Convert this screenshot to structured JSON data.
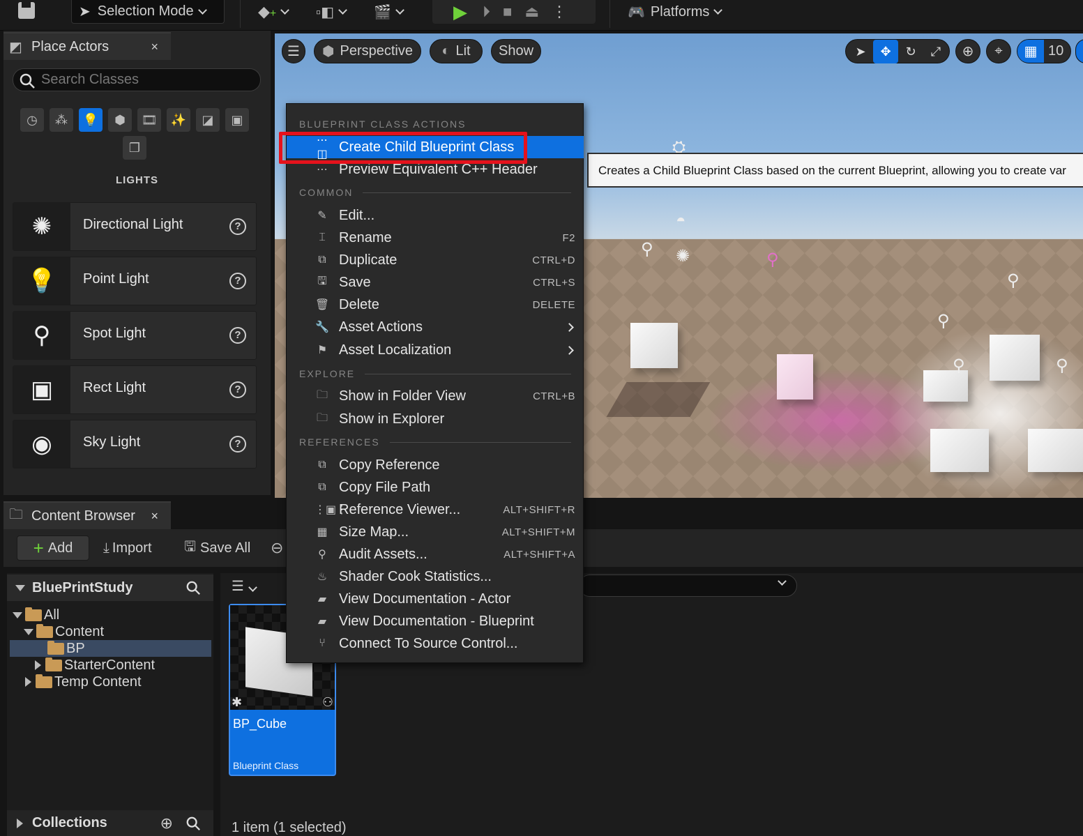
{
  "toolbar": {
    "mode_label": "Selection Mode",
    "platforms_label": "Platforms"
  },
  "place_actors": {
    "tab_title": "Place Actors",
    "close": "×",
    "search_placeholder": "Search Classes",
    "category_heading": "LIGHTS",
    "categories": [
      "recent-icon",
      "basic-icon",
      "lights-icon",
      "shapes-icon",
      "cinematic-icon",
      "visual-effects-icon",
      "geometry-icon",
      "volumes-icon",
      "all-classes-icon"
    ],
    "items": [
      {
        "label": "Directional Light",
        "icon": "directional-light-icon"
      },
      {
        "label": "Point Light",
        "icon": "point-light-icon"
      },
      {
        "label": "Spot Light",
        "icon": "spot-light-icon"
      },
      {
        "label": "Rect Light",
        "icon": "rect-light-icon"
      },
      {
        "label": "Sky Light",
        "icon": "sky-light-icon"
      }
    ]
  },
  "viewport": {
    "perspective_label": "Perspective",
    "lit_label": "Lit",
    "show_label": "Show",
    "grid_value": "10"
  },
  "tooltip": {
    "text": "Creates a Child Blueprint Class based on the current Blueprint, allowing you to create var"
  },
  "context_menu": {
    "sections": {
      "blueprint": "BLUEPRINT CLASS ACTIONS",
      "common": "COMMON",
      "explore": "EXPLORE",
      "references": "REFERENCES"
    },
    "items": {
      "create_child": {
        "label": "Create Child Blueprint Class",
        "shortcut": ""
      },
      "preview_header": {
        "label": "Preview Equivalent C++ Header",
        "shortcut": ""
      },
      "edit": {
        "label": "Edit...",
        "shortcut": ""
      },
      "rename": {
        "label": "Rename",
        "shortcut": "F2"
      },
      "duplicate": {
        "label": "Duplicate",
        "shortcut": "CTRL+D"
      },
      "save": {
        "label": "Save",
        "shortcut": "CTRL+S"
      },
      "delete": {
        "label": "Delete",
        "shortcut": "DELETE"
      },
      "asset_actions": {
        "label": "Asset Actions",
        "shortcut": ""
      },
      "asset_localization": {
        "label": "Asset Localization",
        "shortcut": ""
      },
      "show_folder": {
        "label": "Show in Folder View",
        "shortcut": "CTRL+B"
      },
      "show_explorer": {
        "label": "Show in Explorer",
        "shortcut": ""
      },
      "copy_reference": {
        "label": "Copy Reference",
        "shortcut": ""
      },
      "copy_file_path": {
        "label": "Copy File Path",
        "shortcut": ""
      },
      "reference_viewer": {
        "label": "Reference Viewer...",
        "shortcut": "ALT+SHIFT+R"
      },
      "size_map": {
        "label": "Size Map...",
        "shortcut": "ALT+SHIFT+M"
      },
      "audit_assets": {
        "label": "Audit Assets...",
        "shortcut": "ALT+SHIFT+A"
      },
      "shader_cook": {
        "label": "Shader Cook Statistics...",
        "shortcut": ""
      },
      "doc_actor": {
        "label": "View Documentation - Actor",
        "shortcut": ""
      },
      "doc_blueprint": {
        "label": "View Documentation - Blueprint",
        "shortcut": ""
      },
      "source_control": {
        "label": "Connect To Source Control...",
        "shortcut": ""
      }
    }
  },
  "content_browser": {
    "tab_title": "Content Browser",
    "close": "×",
    "add_label": "Add",
    "import_label": "Import",
    "save_all_label": "Save All",
    "project_name": "BluePrintStudy",
    "tree": {
      "all": "All",
      "content": "Content",
      "bp": "BP",
      "starter": "StarterContent",
      "temp": "Temp Content"
    },
    "collections_label": "Collections",
    "asset": {
      "name": "BP_Cube",
      "type": "Blueprint Class"
    },
    "status": "1 item (1 selected)"
  },
  "colors": {
    "accent": "#0e70e0",
    "highlight_box": "#e5121c",
    "folder": "#c99a56"
  }
}
